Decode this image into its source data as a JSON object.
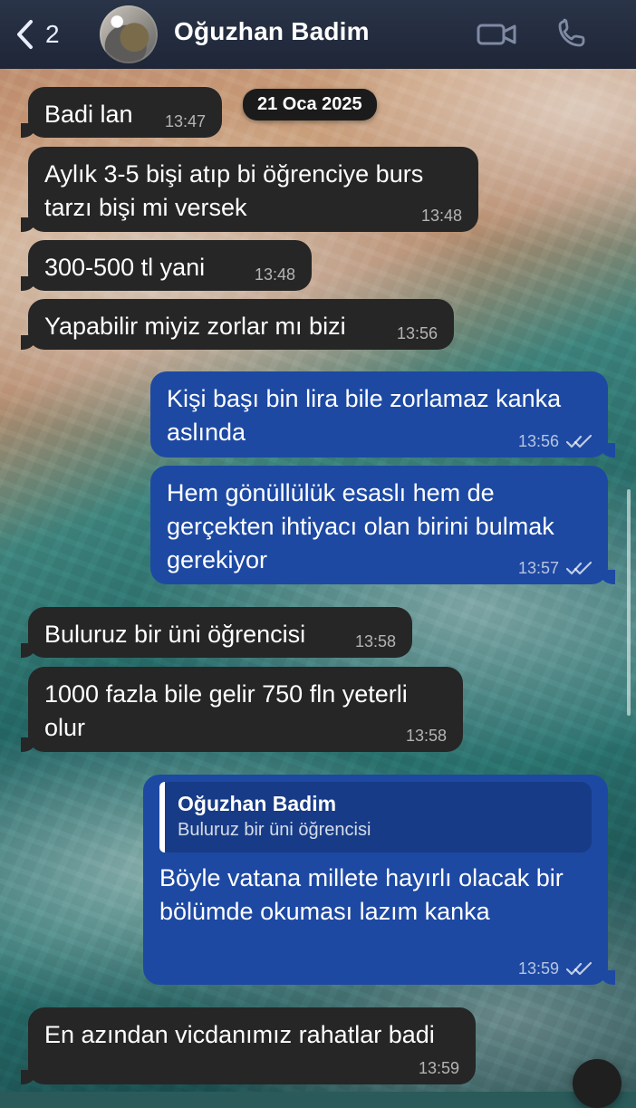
{
  "header": {
    "back_count": "2",
    "contact_name": "Oğuzhan Badim",
    "video_icon": "video-camera-icon",
    "phone_icon": "phone-icon"
  },
  "date_divider": "21 Oca 2025",
  "messages": [
    {
      "dir": "in",
      "text": "Badi lan",
      "time": "13:47"
    },
    {
      "dir": "in",
      "text": "Aylık 3-5 bişi atıp bi öğrenciye burs\ntarzı bişi mi versek",
      "time": "13:48"
    },
    {
      "dir": "in",
      "text": "300-500 tl yani",
      "time": "13:48"
    },
    {
      "dir": "in",
      "text": "Yapabilir miyiz zorlar mı bizi",
      "time": "13:56"
    },
    {
      "dir": "out",
      "text": "Kişi başı bin lira bile zorlamaz kanka\naslında",
      "time": "13:56"
    },
    {
      "dir": "out",
      "text": "Hem gönüllülük esaslı hem de\ngerçekten ihtiyacı olan birini bulmak\ngerekiyor",
      "time": "13:57"
    },
    {
      "dir": "in",
      "text": "Buluruz bir üni öğrencisi",
      "time": "13:58"
    },
    {
      "dir": "in",
      "text": "1000 fazla bile gelir 750 fln yeterli\nolur",
      "time": "13:58"
    },
    {
      "dir": "out",
      "reply": {
        "name": "Oğuzhan Badim",
        "text": "Buluruz bir üni öğrencisi"
      },
      "text": "Böyle vatana millete hayırlı olacak bir\nbölümde okuması lazım kanka",
      "time": "13:59"
    },
    {
      "dir": "in",
      "text": "En azından vicdanımız rahatlar badi",
      "time": "13:59"
    }
  ],
  "colors": {
    "incoming_bubble": "#262626",
    "outgoing_bubble": "#1d49a3",
    "header_bg": "#1e2637"
  }
}
